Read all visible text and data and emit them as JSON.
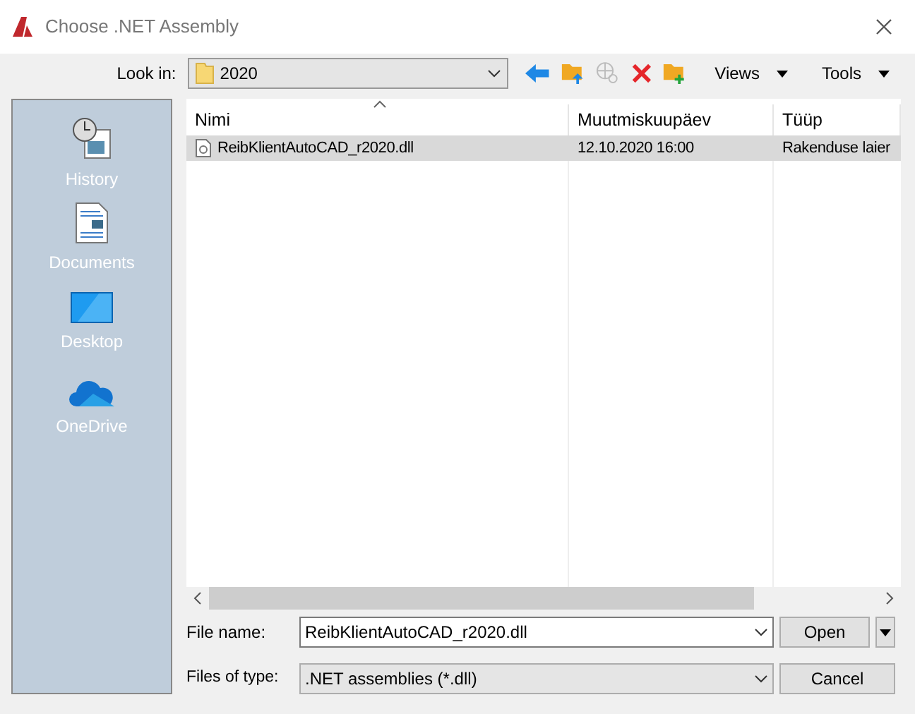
{
  "window": {
    "title": "Choose .NET Assembly"
  },
  "toolbar": {
    "look_in_label": "Look in:",
    "look_in_value": "2020",
    "views": "Views",
    "tools": "Tools"
  },
  "sidebar": {
    "items": [
      {
        "kind": "history",
        "label": "History"
      },
      {
        "kind": "documents",
        "label": "Documents"
      },
      {
        "kind": "desktop",
        "label": "Desktop"
      },
      {
        "kind": "onedrive",
        "label": "OneDrive"
      }
    ]
  },
  "table": {
    "columns": [
      "Nimi",
      "Muutmiskuupäev",
      "Tüüp"
    ],
    "rows": [
      {
        "selected": true,
        "cells": [
          "ReibKlientAutoCAD_r2020.dll",
          "12.10.2020 16:00",
          "Rakenduse laier"
        ]
      }
    ]
  },
  "file_name": {
    "label": "File name:",
    "value": "ReibKlientAutoCAD_r2020.dll"
  },
  "file_type": {
    "label": "Files of type:",
    "value": ".NET assemblies (*.dll)"
  },
  "buttons": {
    "open": "Open",
    "cancel": "Cancel"
  }
}
